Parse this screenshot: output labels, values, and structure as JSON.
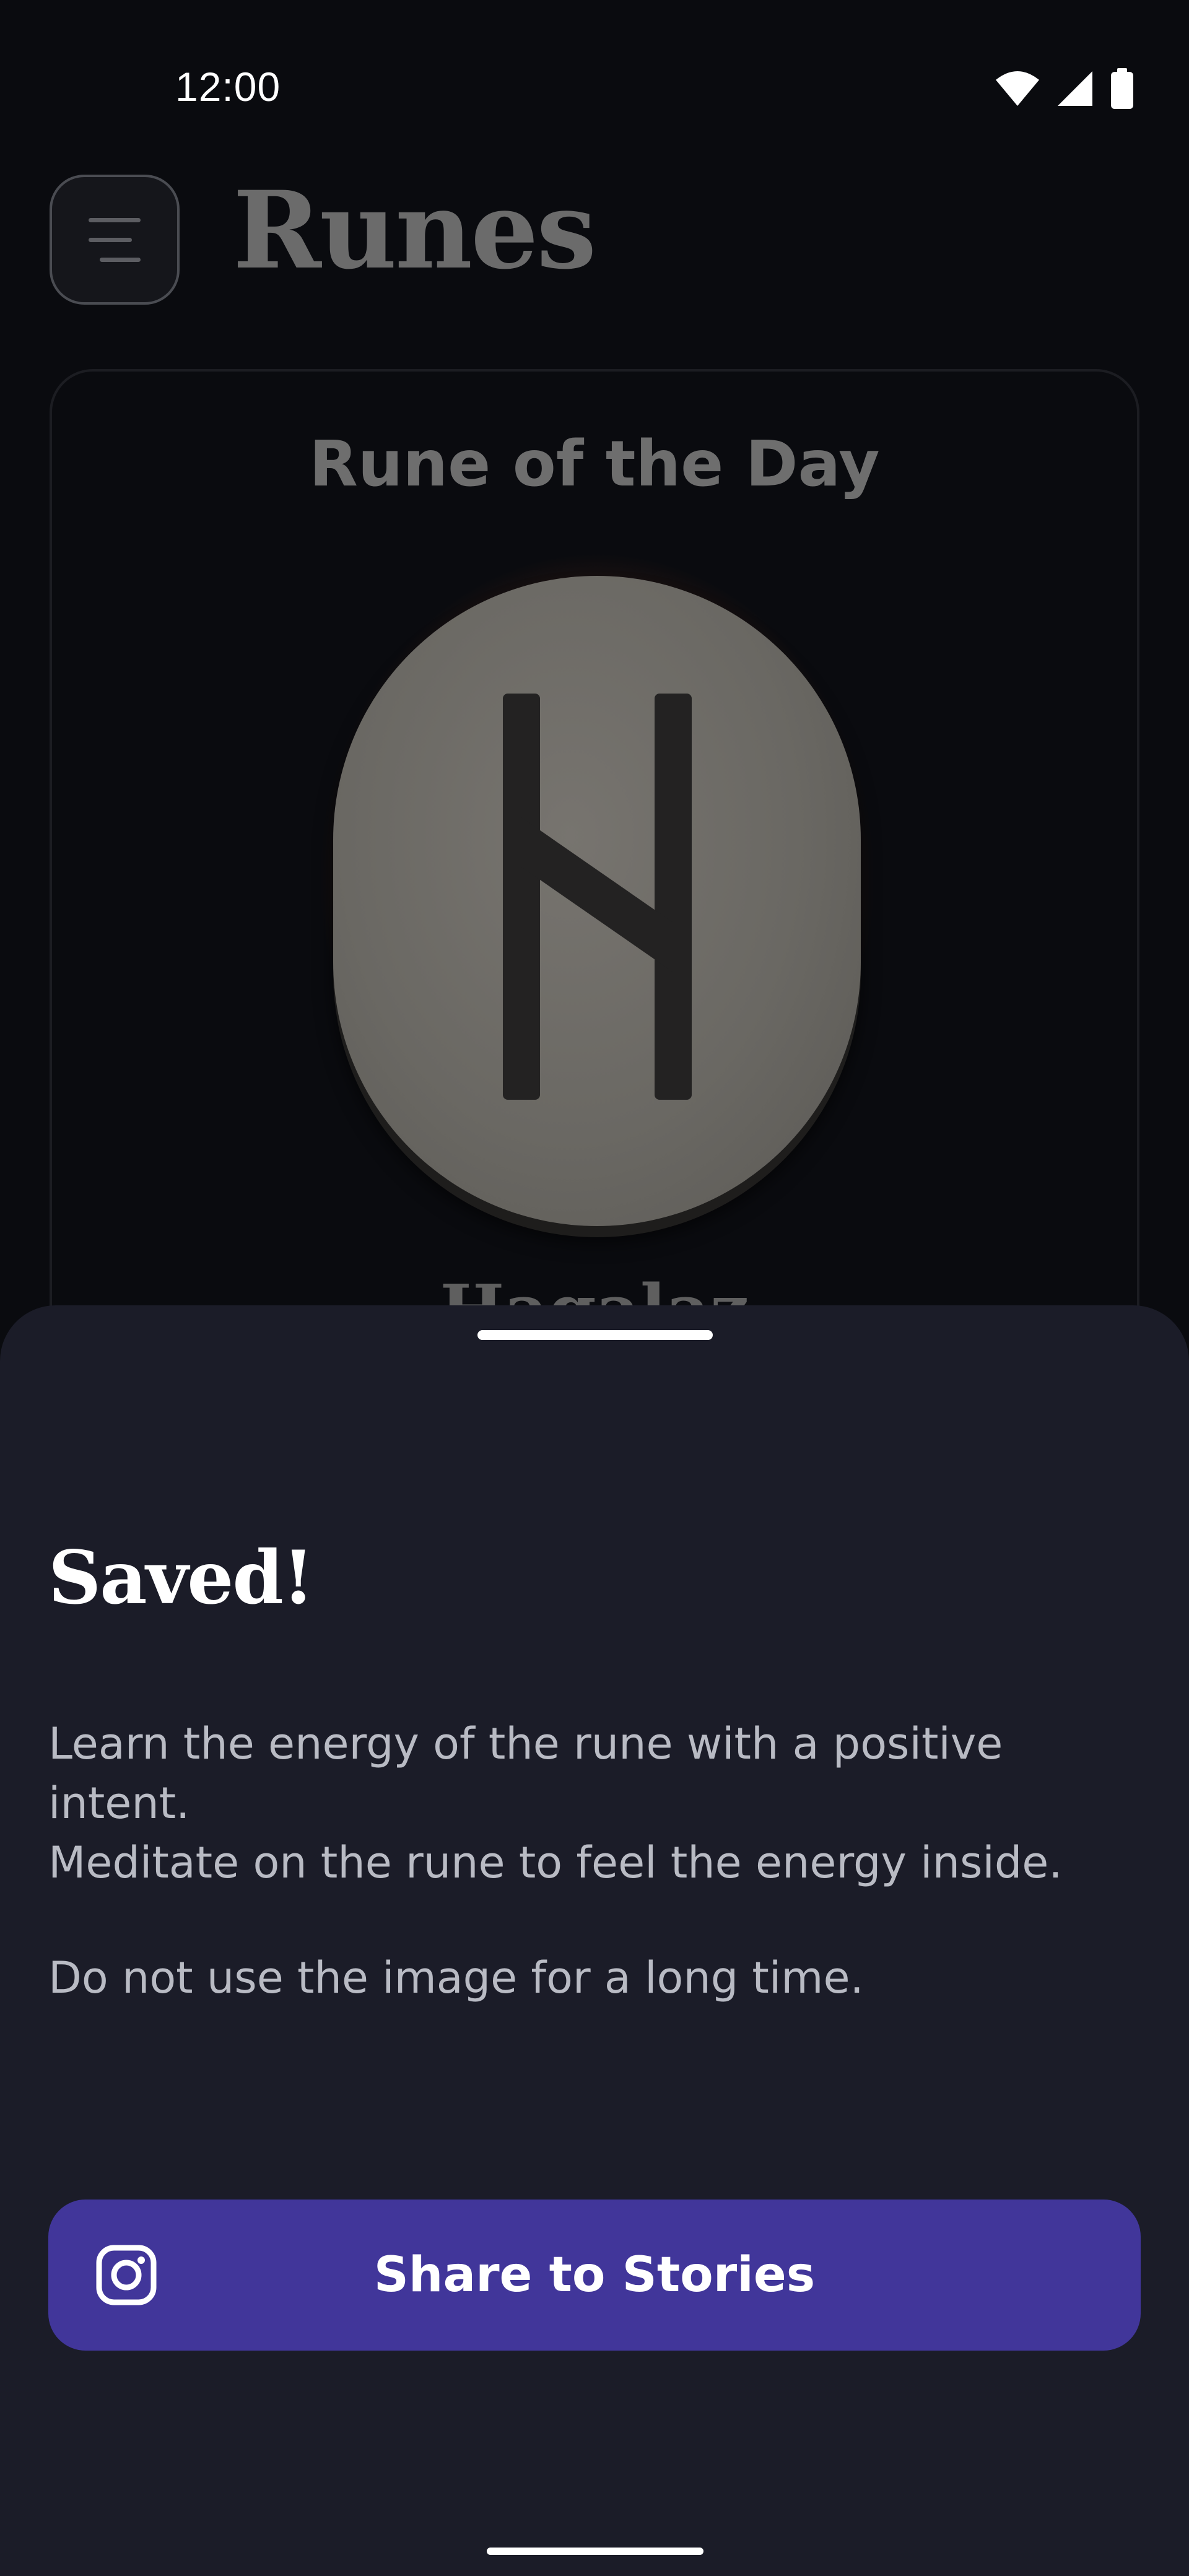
{
  "status_bar": {
    "time": "12:00",
    "icons": [
      "wifi-icon",
      "signal-icon",
      "battery-icon"
    ]
  },
  "header": {
    "menu_icon": "menu-icon",
    "title": "Runes"
  },
  "rune_card": {
    "title": "Rune of the Day",
    "rune_name": "Hagalaz",
    "rune_image": "hagalaz-rune-stone"
  },
  "sheet": {
    "title": "Saved!",
    "body_line_1": "Learn the energy of the rune with a positive intent.",
    "body_line_2": "Meditate on the rune to feel the energy inside.",
    "body_line_3": "Do not use the image for a long time.",
    "share_button": {
      "label": "Share to Stories",
      "icon": "instagram-icon"
    }
  },
  "colors": {
    "background": "#0a0b0f",
    "sheet": "#1b1c28",
    "accent": "#41369a",
    "glow": "#be5523"
  }
}
